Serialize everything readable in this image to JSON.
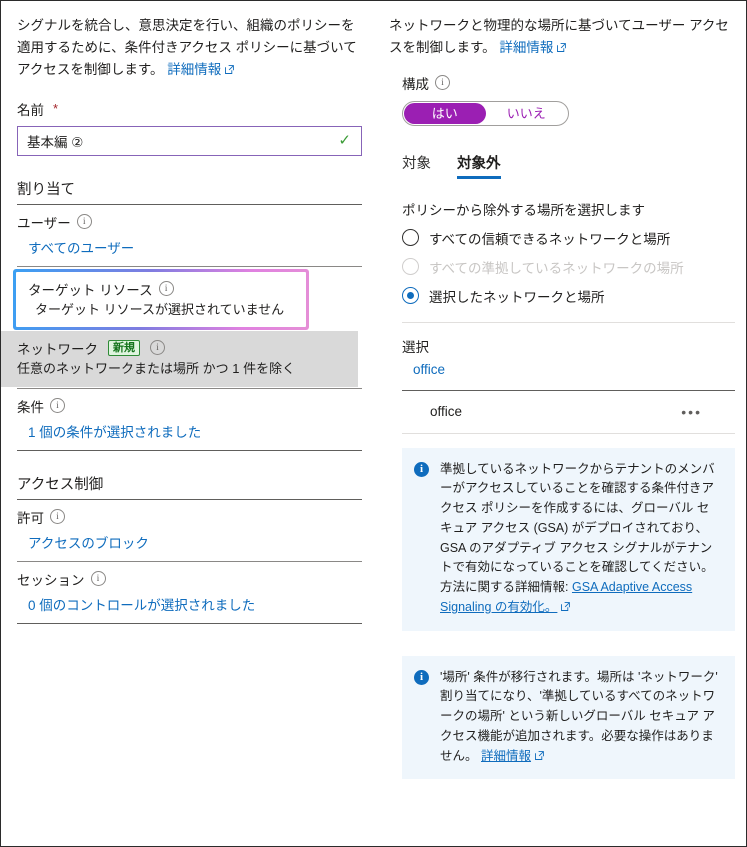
{
  "left": {
    "intro": "シグナルを統合し、意思決定を行い、組織のポリシーを適用するために、条件付きアクセス ポリシーに基づいてアクセスを制御します。",
    "intro_link": "詳細情報",
    "name_label": "名前",
    "name_required_mark": "*",
    "name_value": "基本編 ②",
    "name_valid_icon": "checkmark-icon",
    "assignments_heading": "割り当て",
    "groups": [
      {
        "label": "ユーザー",
        "value": "すべてのユーザー"
      },
      {
        "label": "ターゲット リソース",
        "value": "ターゲット リソースが選択されていません"
      },
      {
        "label": "ネットワーク",
        "badge": "新規",
        "value": "任意のネットワークまたは場所 かつ 1 件を除く"
      },
      {
        "label": "条件",
        "value": "1 個の条件が選択されました"
      }
    ],
    "access_control_heading": "アクセス制御",
    "grant": {
      "label": "許可",
      "value": "アクセスのブロック"
    },
    "session": {
      "label": "セッション",
      "value": "0 個のコントロールが選択されました"
    }
  },
  "right": {
    "intro": "ネットワークと物理的な場所に基づいてユーザー アクセスを制御します。",
    "intro_link": "詳細情報",
    "configure_label": "構成",
    "toggle": {
      "on_label": "はい",
      "off_label": "いいえ",
      "selected": "はい",
      "accent": "#9b1fb3"
    },
    "tabs": [
      {
        "label": "対象",
        "active": false
      },
      {
        "label": "対象外",
        "active": true
      }
    ],
    "exclude_prompt": "ポリシーから除外する場所を選択します",
    "radios": [
      {
        "label": "すべての信頼できるネットワークと場所",
        "checked": false,
        "disabled": false
      },
      {
        "label": "すべての準拠しているネットワークの場所",
        "checked": false,
        "disabled": true
      },
      {
        "label": "選択したネットワークと場所",
        "checked": true,
        "disabled": false
      }
    ],
    "selection_label": "選択",
    "selection_link": "office",
    "list_rows": [
      {
        "name": "office",
        "menu": "ellipsis-icon"
      }
    ],
    "callouts": [
      {
        "text": "準拠しているネットワークからテナントのメンバーがアクセスしていることを確認する条件付きアクセス ポリシーを作成するには、グローバル セキュア アクセス (GSA) がデプロイされており、GSA のアダプティブ アクセス シグナルがテナントで有効になっていることを確認してください。方法に関する詳細情報:",
        "link": "GSA Adaptive Access Signaling の有効化。"
      },
      {
        "text": "'場所' 条件が移行されます。場所は 'ネットワーク' 割り当てになり、'準拠しているすべてのネットワークの場所' という新しいグローバル セキュア アクセス機能が追加されます。必要な操作はありません。",
        "link": "詳細情報"
      }
    ]
  },
  "colors": {
    "link": "#0f6cbd",
    "accent_purple": "#9b1fb3",
    "field_border": "#8764b8",
    "valid_green": "#3a9b35",
    "badge_green": "#2e8b36",
    "callout_bg": "#eff6fc",
    "highlight_band": "#d9d9d9"
  }
}
